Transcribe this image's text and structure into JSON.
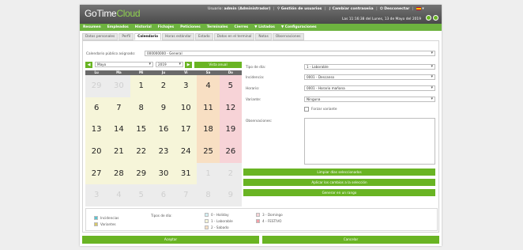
{
  "header": {
    "logo_part1": "GoTime",
    "logo_part2": "Cloud",
    "user_label": "Usuario:",
    "user_name": "admin (Administrador)",
    "users_link": "Gestión de usuarios",
    "change_password": "Cambiar contraseña",
    "logout": "Desconectar",
    "last_access": "Las 11:16:38 del Lunes, 13 de Mayo del 2019",
    "colors": {
      "brand_green": "#69b423",
      "header_gray": "#5a5a5a"
    }
  },
  "menu": [
    "Resumen",
    "Empleados",
    "Historial",
    "Fichajes",
    "Peticiones",
    "Terminales",
    "Cierres",
    "▼ Listados",
    "▼ Configuraciones"
  ],
  "tabs": [
    "Datos personales",
    "Perfil",
    "Calendario",
    "Horas estándar",
    "Estado",
    "Datos en el terminal",
    "Notas",
    "Observaciones"
  ],
  "active_tab": "Calendario",
  "calendar_public": {
    "label": "Calendario público asignado:",
    "value": "000000000 - General"
  },
  "nav": {
    "month": "Mayo",
    "year": "2019",
    "annual_view": "Vista anual",
    "prev": "◀",
    "next": "▶"
  },
  "weekdays": [
    "Lu",
    "Ma",
    "Mi",
    "Ju",
    "Vi",
    "Sa",
    "Do"
  ],
  "weeks": [
    [
      {
        "d": "29",
        "t": "out"
      },
      {
        "d": "30",
        "t": "out"
      },
      {
        "d": "1",
        "t": "w"
      },
      {
        "d": "2",
        "t": "w"
      },
      {
        "d": "3",
        "t": "w"
      },
      {
        "d": "4",
        "t": "sat"
      },
      {
        "d": "5",
        "t": "sun"
      }
    ],
    [
      {
        "d": "6",
        "t": "w"
      },
      {
        "d": "7",
        "t": "w"
      },
      {
        "d": "8",
        "t": "w"
      },
      {
        "d": "9",
        "t": "w"
      },
      {
        "d": "10",
        "t": "w"
      },
      {
        "d": "11",
        "t": "sat"
      },
      {
        "d": "12",
        "t": "sun"
      }
    ],
    [
      {
        "d": "13",
        "t": "w"
      },
      {
        "d": "14",
        "t": "w"
      },
      {
        "d": "15",
        "t": "w"
      },
      {
        "d": "16",
        "t": "w"
      },
      {
        "d": "17",
        "t": "w"
      },
      {
        "d": "18",
        "t": "sat"
      },
      {
        "d": "19",
        "t": "sun"
      }
    ],
    [
      {
        "d": "20",
        "t": "w"
      },
      {
        "d": "21",
        "t": "w"
      },
      {
        "d": "22",
        "t": "w"
      },
      {
        "d": "23",
        "t": "w"
      },
      {
        "d": "24",
        "t": "w"
      },
      {
        "d": "25",
        "t": "sat"
      },
      {
        "d": "26",
        "t": "sun"
      }
    ],
    [
      {
        "d": "27",
        "t": "w"
      },
      {
        "d": "28",
        "t": "w"
      },
      {
        "d": "29",
        "t": "w"
      },
      {
        "d": "30",
        "t": "w"
      },
      {
        "d": "31",
        "t": "w"
      },
      {
        "d": "1",
        "t": "out"
      },
      {
        "d": "2",
        "t": "out"
      }
    ],
    [
      {
        "d": "3",
        "t": "out"
      },
      {
        "d": "4",
        "t": "out"
      },
      {
        "d": "5",
        "t": "out"
      },
      {
        "d": "6",
        "t": "out"
      },
      {
        "d": "7",
        "t": "out"
      },
      {
        "d": "8",
        "t": "out"
      },
      {
        "d": "9",
        "t": "out"
      }
    ]
  ],
  "form": {
    "day_type": {
      "label": "Tipo de día:",
      "value": "1 - Laborable"
    },
    "incidence": {
      "label": "Incidencia:",
      "value": "0001 - Descanso"
    },
    "schedule": {
      "label": "Horario:",
      "value": "0001 - Horario mañana"
    },
    "variant": {
      "label": "Variante:",
      "value": "Ninguna"
    },
    "force_variant": "Forzar variante",
    "observations": "Observaciones:"
  },
  "actions": {
    "clear_days": "Limpiar días seleccionados",
    "apply": "Aplicar los cambios a la selección",
    "generate": "Generar en un rango"
  },
  "legend": {
    "items": [
      {
        "label": "Incidencias",
        "color": "#5bc4d1"
      },
      {
        "label": "Variantes",
        "color": "#d8c86b"
      }
    ],
    "types_label": "Tipos de día:",
    "types": [
      {
        "label": "0 - Holiday",
        "color": "#d4f1f4"
      },
      {
        "label": "1 - Laborable",
        "color": "#f6f5d9"
      },
      {
        "label": "2 - Sabado",
        "color": "#f8dfc3"
      },
      {
        "label": "3 - Domingo",
        "color": "#f7d3d7"
      },
      {
        "label": "4 - FESTIVO",
        "color": "#f4a0a8"
      }
    ]
  },
  "footer": {
    "accept": "Aceptar",
    "cancel": "Cancelar"
  }
}
